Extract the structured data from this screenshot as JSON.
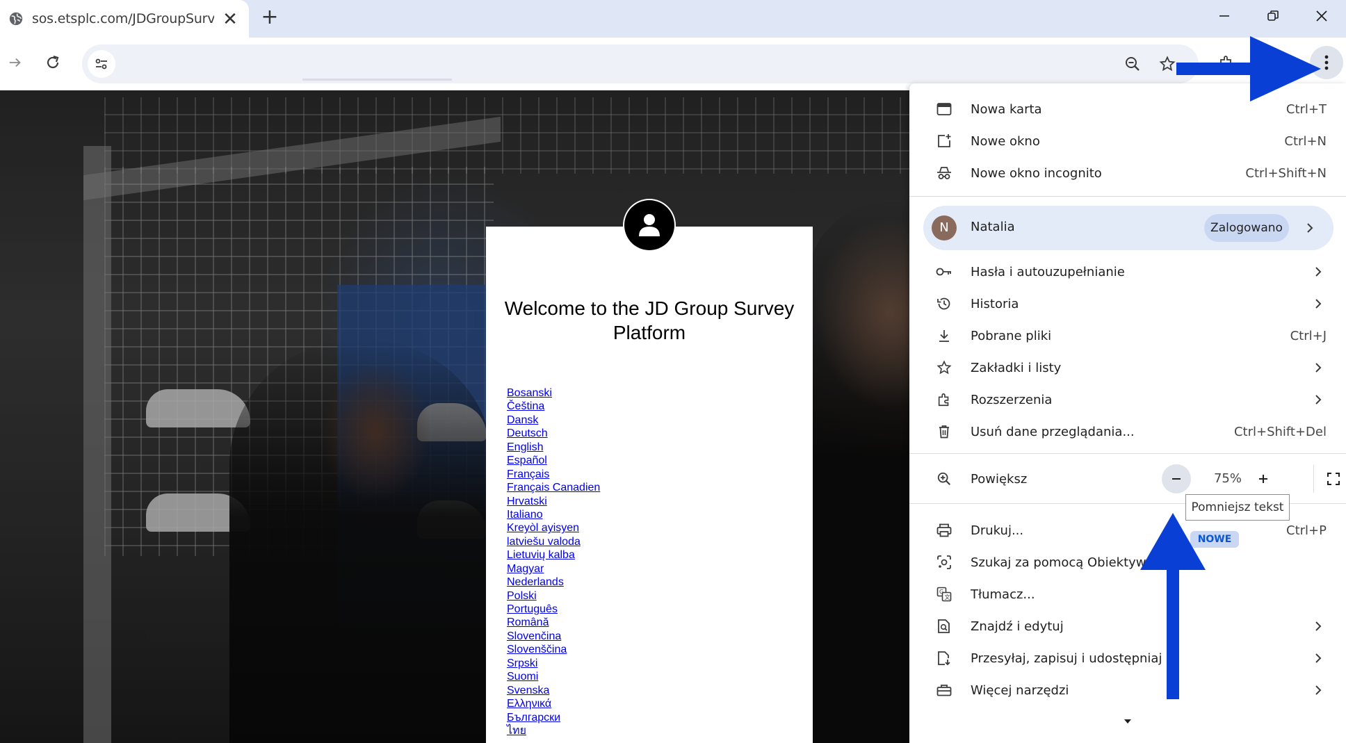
{
  "browser": {
    "tab": {
      "title": "sos.etsplc.com/JDGroupSurvey/",
      "close": "✕"
    },
    "new_tab": "+",
    "window_controls": {
      "minimize": "minimize",
      "restore": "restore",
      "close": "close"
    }
  },
  "page": {
    "heading": "Welcome to the JD Group Survey Platform",
    "languages": [
      "Bosanski",
      "Čeština",
      "Dansk",
      "Deutsch",
      "English",
      "Español",
      "Français",
      "Français Canadien",
      "Hrvatski",
      "Italiano",
      "Kreyòl ayisyen",
      "latviešu valoda",
      "Lietuvių kalba",
      "Magyar",
      "Nederlands",
      "Polski",
      "Português",
      "Română",
      "Slovenčina",
      "Slovenščina",
      "Srpski",
      "Suomi",
      "Svenska",
      "Ελληνικά",
      "Български",
      "ไทย"
    ]
  },
  "menu": {
    "new_tab": {
      "label": "Nowa karta",
      "shortcut": "Ctrl+T"
    },
    "new_window": {
      "label": "Nowe okno",
      "shortcut": "Ctrl+N"
    },
    "incognito": {
      "label": "Nowe okno incognito",
      "shortcut": "Ctrl+Shift+N"
    },
    "profile": {
      "initial": "N",
      "name": "Natalia",
      "status": "Zalogowano"
    },
    "passwords": {
      "label": "Hasła i autouzupełnianie"
    },
    "history": {
      "label": "Historia"
    },
    "downloads": {
      "label": "Pobrane pliki",
      "shortcut": "Ctrl+J"
    },
    "bookmarks": {
      "label": "Zakładki i listy"
    },
    "extensions": {
      "label": "Rozszerzenia"
    },
    "clear_data": {
      "label": "Usuń dane przeglądania...",
      "shortcut": "Ctrl+Shift+Del"
    },
    "zoom": {
      "label": "Powiększ",
      "value": "75%",
      "minus": "−",
      "plus": "+",
      "tooltip": "Pomniejsz tekst"
    },
    "print": {
      "label": "Drukuj...",
      "shortcut": "Ctrl+P"
    },
    "lens": {
      "label": "Szukaj za pomocą Obiektywu G",
      "badge": "NOWE"
    },
    "translate": {
      "label": "Tłumacz..."
    },
    "find_edit": {
      "label": "Znajdź i edytuj"
    },
    "cast_save_share": {
      "label": "Przesyłaj, zapisuj i udostępniaj"
    },
    "more_tools": {
      "label": "Więcej narzędzi"
    }
  },
  "colors": {
    "annotation_arrow": "#0a3fd6",
    "link": "#0000ee",
    "profile_highlight": "#e3eaf8",
    "tabstrip": "#dfe7f7"
  },
  "icons": {
    "tab": "globe-icon",
    "toolbar": [
      "forward-icon",
      "reload-icon",
      "site-settings-icon",
      "zoom-icon",
      "bookmark-star-icon",
      "extensions-icon",
      "profile-icon",
      "kebab-menu-icon"
    ]
  }
}
